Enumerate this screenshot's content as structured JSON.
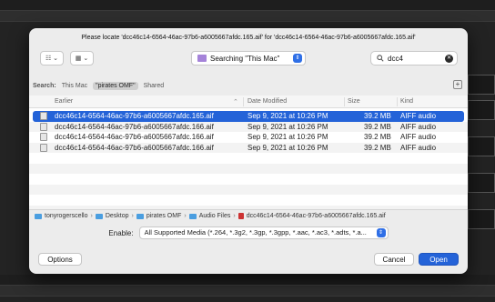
{
  "dialog": {
    "title": "Please locate 'dcc46c14-6564-46ac-97b6-a6005667afdc.165.aif' for 'dcc46c14-6564-46ac-97b6-a6005667afdc.165.aif'"
  },
  "toolbar": {
    "list_view_label": "☷ ⌄",
    "grid_view_label": "▦ ⌄",
    "location": "Searching \"This Mac\"",
    "search_value": "dcc4"
  },
  "scope": {
    "label": "Search:",
    "options": [
      "This Mac",
      "\"pirates OMF\"",
      "Shared"
    ]
  },
  "table": {
    "headers": {
      "name": "Earlier",
      "date": "Date Modified",
      "size": "Size",
      "kind": "Kind"
    },
    "rows": [
      {
        "name": "dcc46c14-6564-46ac-97b6-a6005667afdc.165.aif",
        "date": "Sep 9, 2021 at 10:26 PM",
        "size": "39.2 MB",
        "kind": "AIFF audio",
        "selected": true
      },
      {
        "name": "dcc46c14-6564-46ac-97b6-a6005667afdc.166.aif",
        "date": "Sep 9, 2021 at 10:26 PM",
        "size": "39.2 MB",
        "kind": "AIFF audio",
        "selected": false
      },
      {
        "name": "dcc46c14-6564-46ac-97b6-a6005667afdc.166.aif",
        "date": "Sep 9, 2021 at 10:26 PM",
        "size": "39.2 MB",
        "kind": "AIFF audio",
        "selected": false
      },
      {
        "name": "dcc46c14-6564-46ac-97b6-a6005667afdc.166.aif",
        "date": "Sep 9, 2021 at 10:26 PM",
        "size": "39.2 MB",
        "kind": "AIFF audio",
        "selected": false
      }
    ]
  },
  "pathbar": [
    "tonyrogerscello",
    "Desktop",
    "pirates OMF",
    "Audio Files",
    "dcc46c14-6564-46ac-97b6-a6005667afdc.165.aif"
  ],
  "enable": {
    "label": "Enable:",
    "value": "All Supported Media (*.264, *.3g2, *.3gp, *.3gpp, *.aac, *.ac3, *.adts, *.a..."
  },
  "buttons": {
    "options": "Options",
    "cancel": "Cancel",
    "open": "Open"
  },
  "colors": {
    "accent": "#2463d8",
    "location_folder": "#a583d9"
  },
  "icons": {
    "search": "search-icon",
    "clear": "clear-search-icon",
    "add": "plus-icon"
  }
}
